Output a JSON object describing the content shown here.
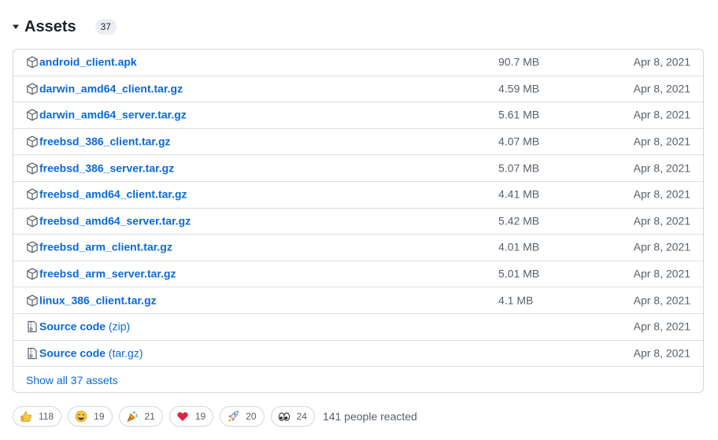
{
  "assets": {
    "title": "Assets",
    "count": "37",
    "show_all_label": "Show all 37 assets",
    "items": [
      {
        "name": "android_client.apk",
        "suffix": "",
        "size": "90.7 MB",
        "date": "Apr 8, 2021",
        "icon": "package-icon"
      },
      {
        "name": "darwin_amd64_client.tar.gz",
        "suffix": "",
        "size": "4.59 MB",
        "date": "Apr 8, 2021",
        "icon": "package-icon"
      },
      {
        "name": "darwin_amd64_server.tar.gz",
        "suffix": "",
        "size": "5.61 MB",
        "date": "Apr 8, 2021",
        "icon": "package-icon"
      },
      {
        "name": "freebsd_386_client.tar.gz",
        "suffix": "",
        "size": "4.07 MB",
        "date": "Apr 8, 2021",
        "icon": "package-icon"
      },
      {
        "name": "freebsd_386_server.tar.gz",
        "suffix": "",
        "size": "5.07 MB",
        "date": "Apr 8, 2021",
        "icon": "package-icon"
      },
      {
        "name": "freebsd_amd64_client.tar.gz",
        "suffix": "",
        "size": "4.41 MB",
        "date": "Apr 8, 2021",
        "icon": "package-icon"
      },
      {
        "name": "freebsd_amd64_server.tar.gz",
        "suffix": "",
        "size": "5.42 MB",
        "date": "Apr 8, 2021",
        "icon": "package-icon"
      },
      {
        "name": "freebsd_arm_client.tar.gz",
        "suffix": "",
        "size": "4.01 MB",
        "date": "Apr 8, 2021",
        "icon": "package-icon"
      },
      {
        "name": "freebsd_arm_server.tar.gz",
        "suffix": "",
        "size": "5.01 MB",
        "date": "Apr 8, 2021",
        "icon": "package-icon"
      },
      {
        "name": "linux_386_client.tar.gz",
        "suffix": "",
        "size": "4.1 MB",
        "date": "Apr 8, 2021",
        "icon": "package-icon"
      },
      {
        "name": "Source code",
        "suffix": " (zip)",
        "size": "",
        "date": "Apr 8, 2021",
        "icon": "file-zip-icon"
      },
      {
        "name": "Source code",
        "suffix": " (tar.gz)",
        "size": "",
        "date": "Apr 8, 2021",
        "icon": "file-zip-icon"
      }
    ]
  },
  "reactions": {
    "items": [
      {
        "emoji": "thumbs-up-icon",
        "count": "118"
      },
      {
        "emoji": "laugh-icon",
        "count": "19"
      },
      {
        "emoji": "hooray-icon",
        "count": "21"
      },
      {
        "emoji": "heart-icon",
        "count": "19"
      },
      {
        "emoji": "rocket-icon",
        "count": "20"
      },
      {
        "emoji": "eyes-icon",
        "count": "24"
      }
    ],
    "summary": "141 people reacted"
  },
  "colors": {
    "link": "#0969da",
    "muted": "#57606a",
    "border": "#d0d7de",
    "badge_bg": "#eaeef2"
  }
}
